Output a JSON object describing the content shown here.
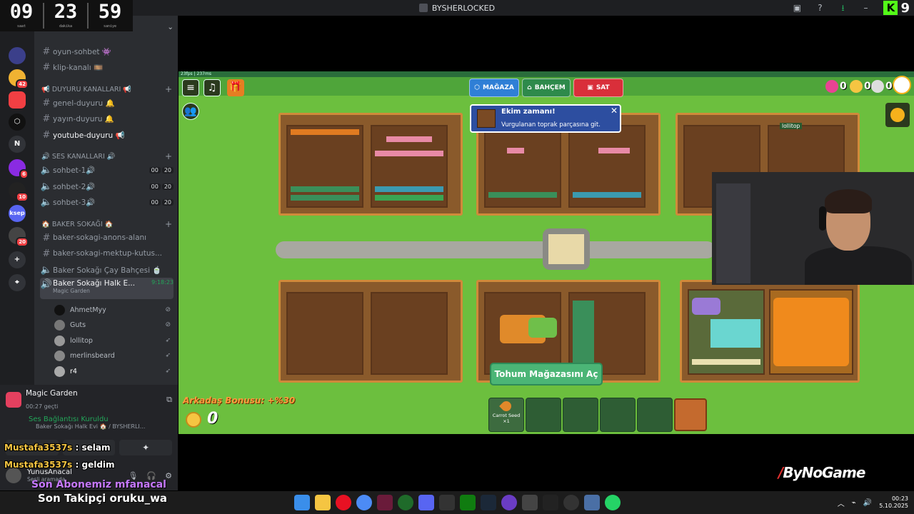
{
  "window": {
    "title": "BYSHERLOCKED"
  },
  "clock": {
    "hours": "09",
    "hours_label": "saat",
    "minutes": "23",
    "minutes_label": "dakika",
    "seconds": "59",
    "seconds_label": "saniye"
  },
  "kick": {
    "letter": "K",
    "count": "9"
  },
  "rail": {
    "servers": [
      {
        "label": "",
        "badge": ""
      },
      {
        "label": "",
        "badge": ""
      },
      {
        "label": "",
        "badge": "42"
      },
      {
        "label": "",
        "badge": ""
      },
      {
        "label": "",
        "badge": ""
      },
      {
        "label": "N",
        "badge": ""
      },
      {
        "label": "",
        "badge": "6"
      },
      {
        "label": "",
        "badge": "10"
      },
      {
        "label": "ksep",
        "badge": ""
      },
      {
        "label": "",
        "badge": "20"
      },
      {
        "label": "+",
        "badge": ""
      },
      {
        "label": "",
        "badge": ""
      }
    ]
  },
  "channels": {
    "text1": "oyun-sohbet 👾",
    "text2": "klip-kanalı 🎞️",
    "cat_duyuru": "📢 DUYURU KANALLARI 📢",
    "duyuru1": "genel-duyuru 🔔",
    "duyuru2": "yayın-duyuru 🔔",
    "duyuru3": "youtube-duyuru 📢",
    "cat_ses": "🔊 SES KANALLARI 🔊",
    "voice1": "sohbet-1🔊",
    "voice2": "sohbet-2🔊",
    "voice3": "sohbet-3🔊",
    "count_left": "00",
    "count_right": "20",
    "cat_baker": "🏠 BAKER SOKAĞI 🏠",
    "baker1": "baker-sokagi-anons-alanı",
    "baker2": "baker-sokagi-mektup-kutus...",
    "baker3": "Baker Sokağı Çay Bahçesi 🍵",
    "baker4": "Baker Sokağı Halk E...",
    "baker4_time": "9:18:23",
    "baker4_activity": "Magic Garden"
  },
  "voice_users": [
    "AhmetMyy",
    "Guts",
    "lollitop",
    "merlinsbeard",
    "r4"
  ],
  "activity": {
    "name": "Magic Garden",
    "elapsed": "00:27 geçti"
  },
  "voice_status": {
    "status": "Ses Bağlantısı Kuruldu",
    "location": "Baker Sokağı Halk Evi 🏠 / BYSHERLI..."
  },
  "me": {
    "name": "YunusAnacal",
    "status": "Sesli aramada"
  },
  "chat": [
    {
      "name": "Mustafa3537s",
      "sep": " : ",
      "message": "selam"
    },
    {
      "name": "Mustafa3537s",
      "sep": " : ",
      "message": "geldim"
    }
  ],
  "overlay": {
    "subscriber": "Son Abonemiz mfanacal",
    "follower": "Son Takipçi oruku_wa"
  },
  "game": {
    "fps": "23fps | 237ms",
    "buttons": {
      "shop": "MAĞAZA",
      "garden": "BAHÇEM",
      "sell": "SAT"
    },
    "stats": [
      "0",
      "0",
      "0"
    ],
    "tooltip": {
      "title": "Ekim zamanı!",
      "body": "Vurgulanan toprak parçasına git."
    },
    "player_tag": "lollitop",
    "seed_shop_button": "Tohum Mağazasını Aç",
    "friend_bonus": "Arkadaş Bonusu: +%30",
    "coins": "0",
    "inventory": {
      "item": "Carrot Seed",
      "qty": "×1"
    },
    "colors": {
      "shop": "#2f7fd6",
      "garden": "#2e8a4b",
      "sell": "#d92f3a",
      "grass": "#6cbf3e",
      "soil": "#8a5a2b"
    }
  },
  "watermark": "ByNoGame",
  "tray": {
    "time": "00:23",
    "date": "5.10.2025"
  }
}
